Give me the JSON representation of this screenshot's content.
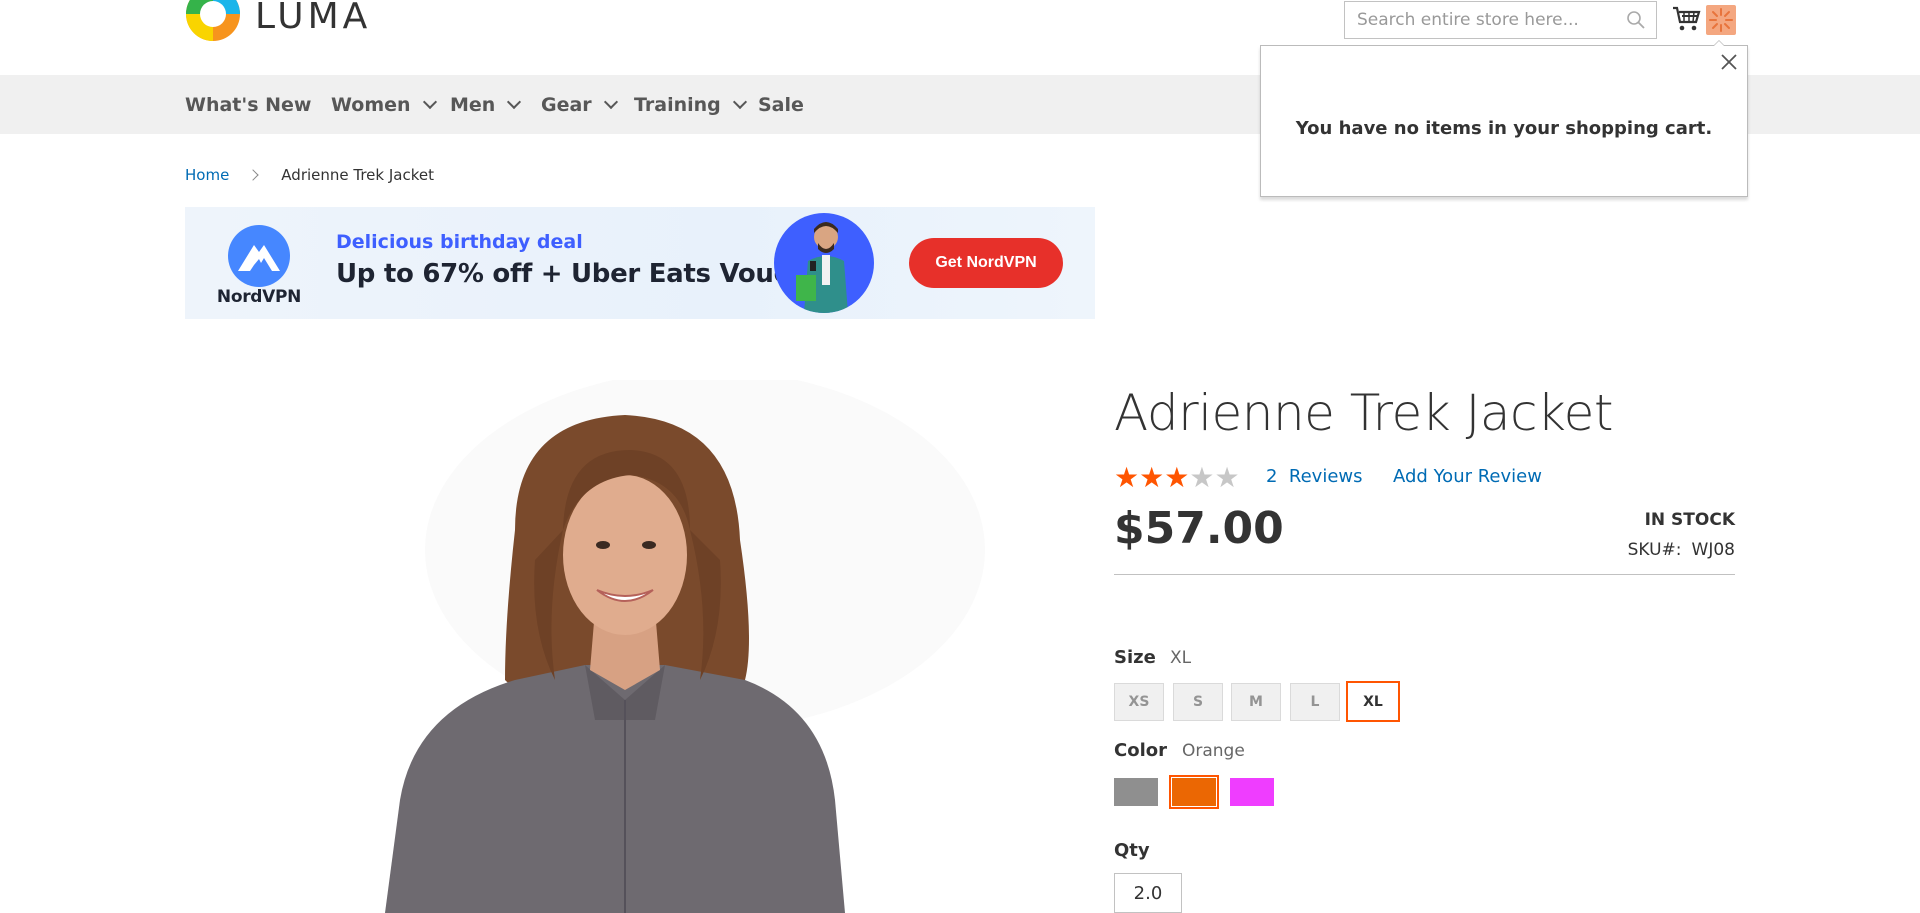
{
  "header": {
    "logo_text": "LUMA",
    "search_placeholder": "Search entire store here..."
  },
  "minicart": {
    "empty_message": "You have no items in your shopping cart."
  },
  "nav": {
    "items": [
      {
        "label": "What's New",
        "has_dropdown": false
      },
      {
        "label": "Women",
        "has_dropdown": true
      },
      {
        "label": "Men",
        "has_dropdown": true
      },
      {
        "label": "Gear",
        "has_dropdown": true
      },
      {
        "label": "Training",
        "has_dropdown": true
      },
      {
        "label": "Sale",
        "has_dropdown": false
      }
    ]
  },
  "breadcrumb": {
    "home": "Home",
    "current": "Adrienne Trek Jacket"
  },
  "ad": {
    "brand": "NordVPN",
    "subtitle": "Delicious birthday deal",
    "headline": "Up to 67% off + Uber Eats Voucher",
    "cta": "Get NordVPN"
  },
  "product": {
    "title": "Adrienne Trek Jacket",
    "rating": 3,
    "rating_max": 5,
    "reviews_count": "2",
    "reviews_label": "Reviews",
    "add_review": "Add Your Review",
    "price": "$57.00",
    "stock": "IN STOCK",
    "sku_label": "SKU#:",
    "sku_value": "WJ08",
    "size_label": "Size",
    "size_selected": "XL",
    "sizes": [
      "XS",
      "S",
      "M",
      "L",
      "XL"
    ],
    "color_label": "Color",
    "color_selected": "Orange",
    "colors": [
      "#8f8f8f",
      "#eb6703",
      "#ef3dff"
    ],
    "qty_label": "Qty",
    "qty_value": "2.0"
  },
  "colors": {
    "accent": "#ff5501",
    "link": "#006bb4",
    "star_filled": "#ff5501",
    "star_empty": "#c7c7c7"
  }
}
